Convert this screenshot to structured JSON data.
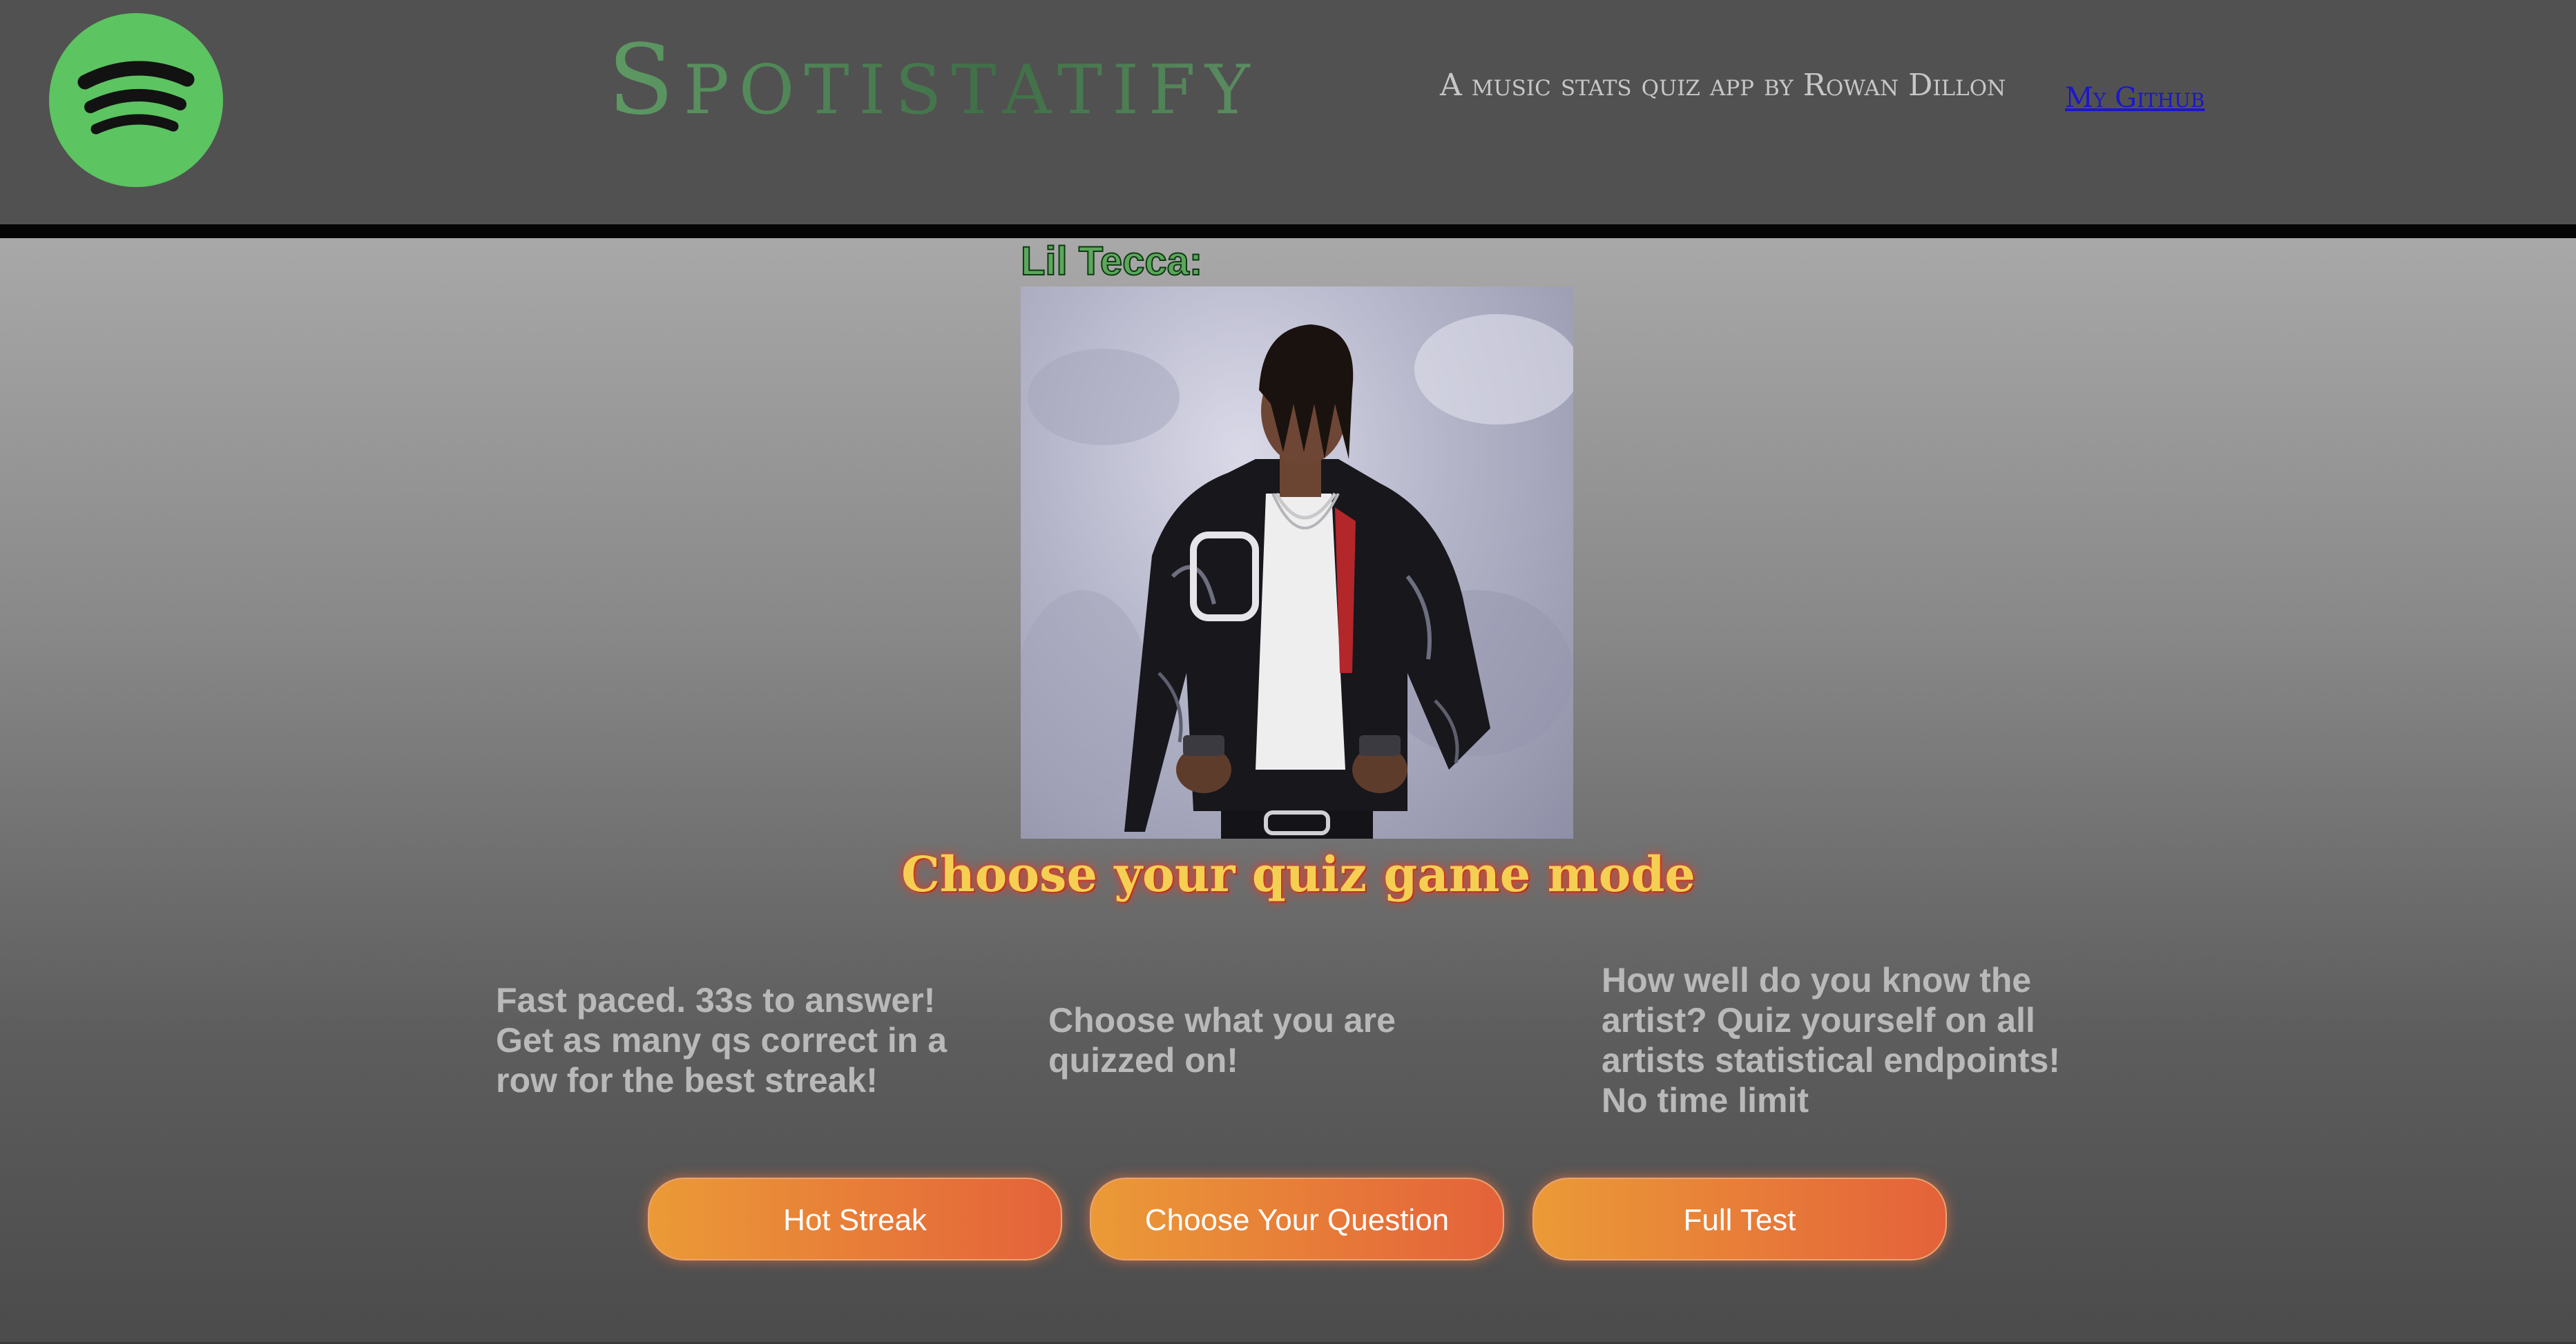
{
  "header": {
    "logo_icon": "spotify-logo-icon",
    "app_title": "Spotistatify",
    "subtitle": "A music stats quiz app by Rowan Dillon",
    "github_link": "My Github"
  },
  "artist": {
    "name": "Lil Tecca:",
    "photo_icon": "artist-photo"
  },
  "quiz": {
    "heading": "Choose your quiz game mode",
    "modes": [
      {
        "description": "Fast paced. 33s to answer! Get as many qs correct in a row for the best streak!",
        "button_label": "Hot Streak"
      },
      {
        "description": "Choose what you are quizzed on!",
        "button_label": "Choose Your Question"
      },
      {
        "description": "How well do you know the artist? Quiz yourself on all artists statistical endpoints! No time limit",
        "button_label": "Full Test"
      }
    ]
  },
  "colors": {
    "header_bg": "#515151",
    "logo_green": "#5cc461",
    "title_green": "#4f8a57",
    "link_blue": "#1b17c9",
    "heading_yellow": "#f5cf52",
    "button_orange_start": "#eb9a37",
    "button_orange_end": "#e4623a"
  }
}
